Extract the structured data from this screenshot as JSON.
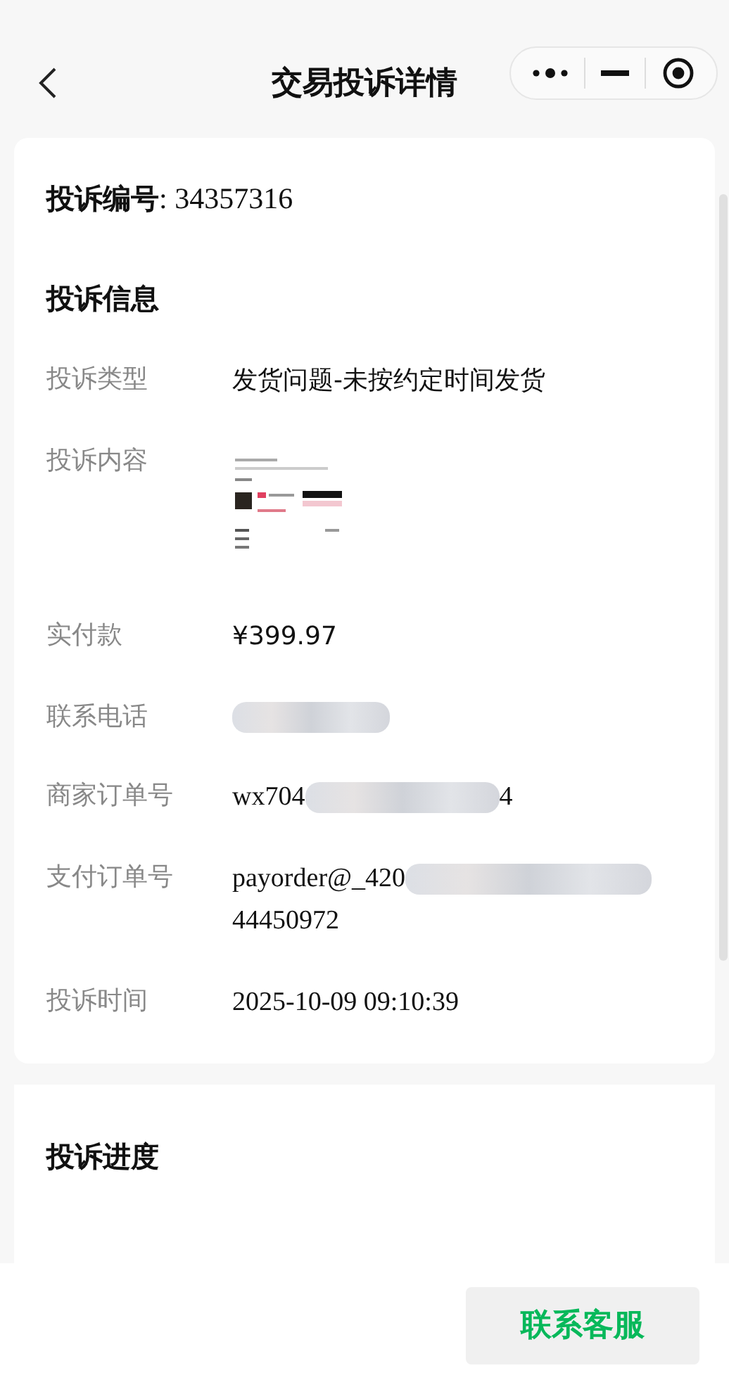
{
  "nav": {
    "title": "交易投诉详情"
  },
  "complaint_id": {
    "label": "投诉编号",
    "value": ": 34357316"
  },
  "info": {
    "heading": "投诉信息",
    "rows": [
      {
        "label": "投诉类型",
        "kind": "text",
        "value": "发货问题-未按约定时间发货"
      },
      {
        "label": "投诉内容",
        "kind": "image"
      },
      {
        "label": "实付款",
        "kind": "amount",
        "value": "¥399.97"
      },
      {
        "label": "联系电话",
        "kind": "number",
        "redacted": true
      },
      {
        "label": "商家订单号",
        "kind": "number",
        "value": "wx704",
        "redacted": true,
        "value_end": "4"
      },
      {
        "label": "支付订单号",
        "kind": "number",
        "value": "payorder@_420",
        "redacted": true,
        "value_end": "44450972"
      },
      {
        "label": "投诉时间",
        "kind": "number",
        "value": "2025-10-09 09:10:39"
      }
    ]
  },
  "progress": {
    "heading": "投诉进度"
  },
  "footer": {
    "button": "联系客服"
  }
}
